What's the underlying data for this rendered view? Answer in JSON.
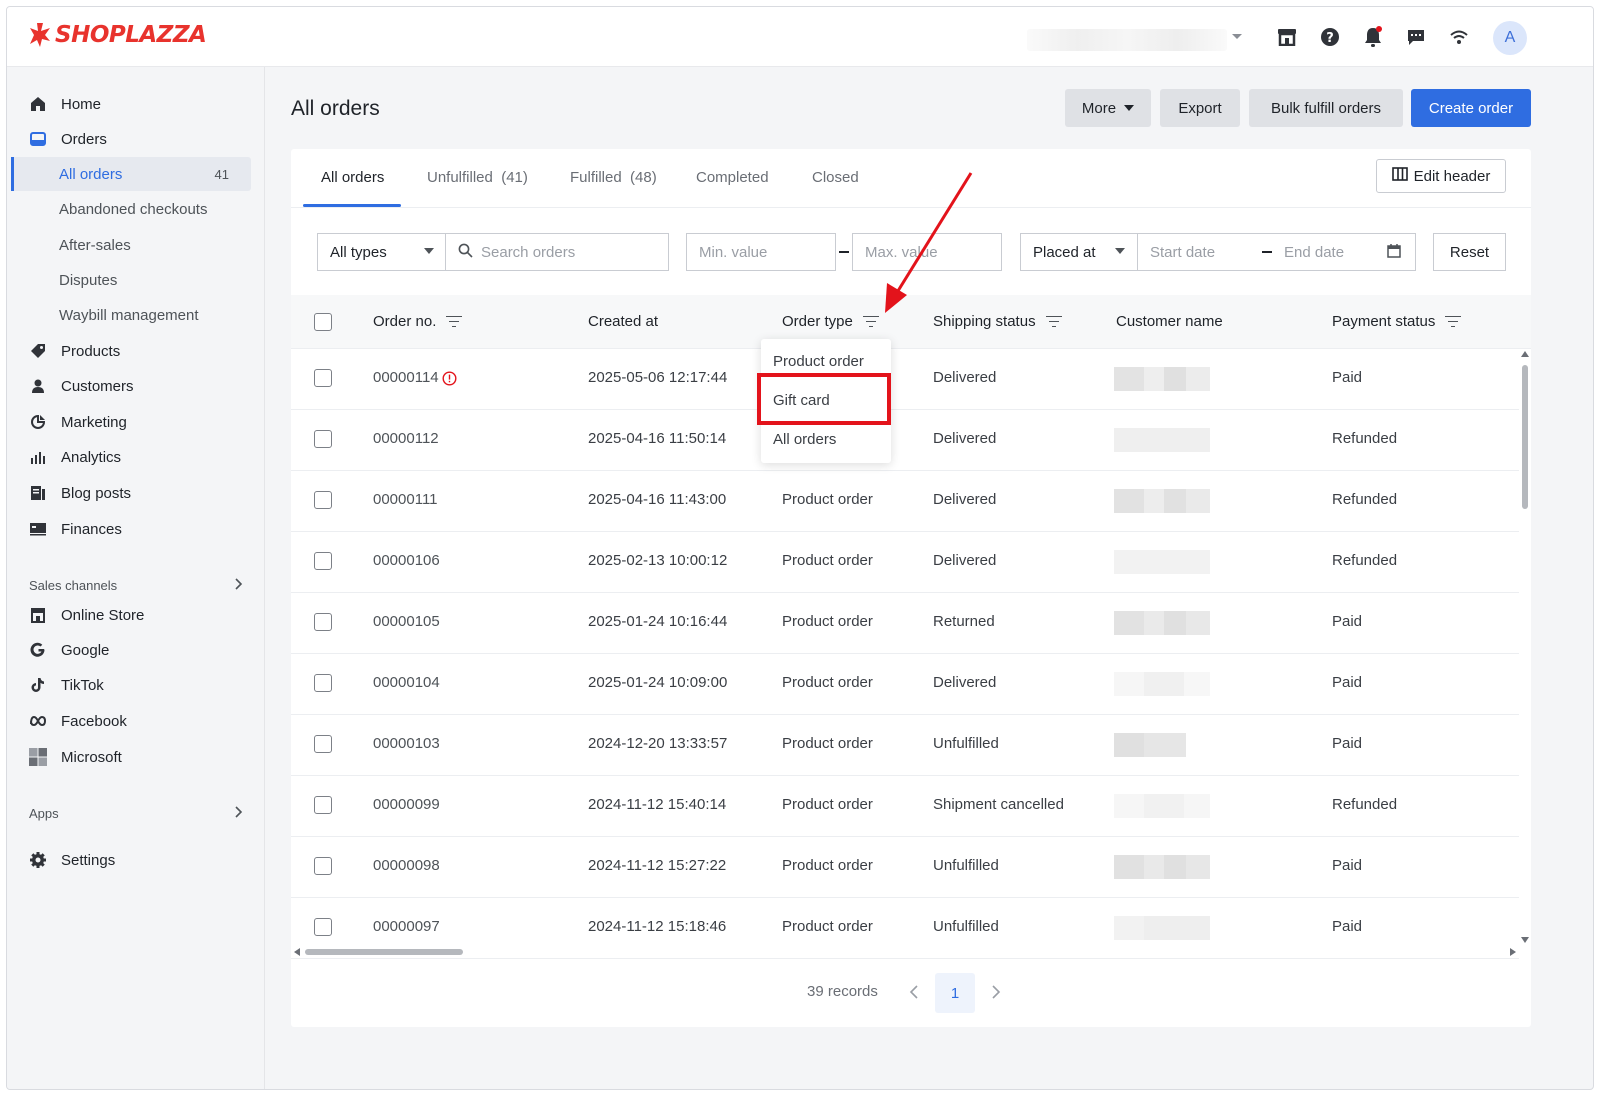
{
  "brand": {
    "name": "SHOPLAZZA",
    "color": "#e8332d"
  },
  "topbar": {
    "icons": [
      "store-icon",
      "help-icon",
      "bell-icon",
      "chat-icon",
      "wifi-icon"
    ],
    "avatar": "A"
  },
  "sidebar": {
    "items": [
      {
        "label": "Home",
        "icon": "home-icon"
      },
      {
        "label": "Orders",
        "icon": "orders-icon"
      },
      {
        "label": "Products",
        "icon": "tag-icon"
      },
      {
        "label": "Customers",
        "icon": "person-icon"
      },
      {
        "label": "Marketing",
        "icon": "marketing-icon"
      },
      {
        "label": "Analytics",
        "icon": "bar-chart-icon"
      },
      {
        "label": "Blog posts",
        "icon": "blog-icon"
      },
      {
        "label": "Finances",
        "icon": "finance-icon"
      }
    ],
    "order_subitems": [
      {
        "label": "All orders",
        "count": "41"
      },
      {
        "label": "Abandoned checkouts"
      },
      {
        "label": "After-sales"
      },
      {
        "label": "Disputes"
      },
      {
        "label": "Waybill management"
      }
    ],
    "sales_channels_label": "Sales channels",
    "channels": [
      {
        "label": "Online Store",
        "icon": "store-icon"
      },
      {
        "label": "Google",
        "icon": "google-icon"
      },
      {
        "label": "TikTok",
        "icon": "tiktok-icon"
      },
      {
        "label": "Facebook",
        "icon": "meta-icon"
      },
      {
        "label": "Microsoft",
        "icon": "microsoft-icon"
      }
    ],
    "apps_label": "Apps",
    "settings_label": "Settings"
  },
  "header": {
    "title": "All orders",
    "more_label": "More",
    "export_label": "Export",
    "bulk_label": "Bulk fulfill orders",
    "create_label": "Create order"
  },
  "tabs": [
    {
      "label": "All orders"
    },
    {
      "label": "Unfulfilled  (41)"
    },
    {
      "label": "Fulfilled  (48)"
    },
    {
      "label": "Completed"
    },
    {
      "label": "Closed"
    }
  ],
  "edit_header_label": "Edit header",
  "filters": {
    "type_value": "All types",
    "search_placeholder": "Search orders",
    "min_placeholder": "Min. value",
    "max_placeholder": "Max. value",
    "date_field_value": "Placed at",
    "start_placeholder": "Start date",
    "end_placeholder": "End date",
    "reset_label": "Reset"
  },
  "columns": [
    "Order no.",
    "Created at",
    "Order type",
    "Shipping status",
    "Customer name",
    "Payment status"
  ],
  "dropdown": {
    "options": [
      "Product order",
      "Gift card",
      "All orders"
    ],
    "highlighted": "Gift card"
  },
  "rows": [
    {
      "order": "00000114",
      "created": "2025-05-06 12:17:44",
      "type": "",
      "shipping": "Delivered",
      "payment": "Paid",
      "alert": true
    },
    {
      "order": "00000112",
      "created": "2025-04-16 11:50:14",
      "type": "",
      "shipping": "Delivered",
      "payment": "Refunded"
    },
    {
      "order": "00000111",
      "created": "2025-04-16 11:43:00",
      "type": "Product order",
      "shipping": "Delivered",
      "payment": "Refunded"
    },
    {
      "order": "00000106",
      "created": "2025-02-13 10:00:12",
      "type": "Product order",
      "shipping": "Delivered",
      "payment": "Refunded"
    },
    {
      "order": "00000105",
      "created": "2025-01-24 10:16:44",
      "type": "Product order",
      "shipping": "Returned",
      "payment": "Paid"
    },
    {
      "order": "00000104",
      "created": "2025-01-24 10:09:00",
      "type": "Product order",
      "shipping": "Delivered",
      "payment": "Paid"
    },
    {
      "order": "00000103",
      "created": "2024-12-20 13:33:57",
      "type": "Product order",
      "shipping": "Unfulfilled",
      "payment": "Paid"
    },
    {
      "order": "00000099",
      "created": "2024-11-12 15:40:14",
      "type": "Product order",
      "shipping": "Shipment cancelled",
      "payment": "Refunded"
    },
    {
      "order": "00000098",
      "created": "2024-11-12 15:27:22",
      "type": "Product order",
      "shipping": "Unfulfilled",
      "payment": "Paid"
    },
    {
      "order": "00000097",
      "created": "2024-11-12 15:18:46",
      "type": "Product order",
      "shipping": "Unfulfilled",
      "payment": "Paid"
    }
  ],
  "pagination": {
    "records": "39 records",
    "current": "1"
  },
  "colors": {
    "accent": "#2f6de1",
    "highlight": "#e3131b",
    "alert": "#e3131b"
  }
}
